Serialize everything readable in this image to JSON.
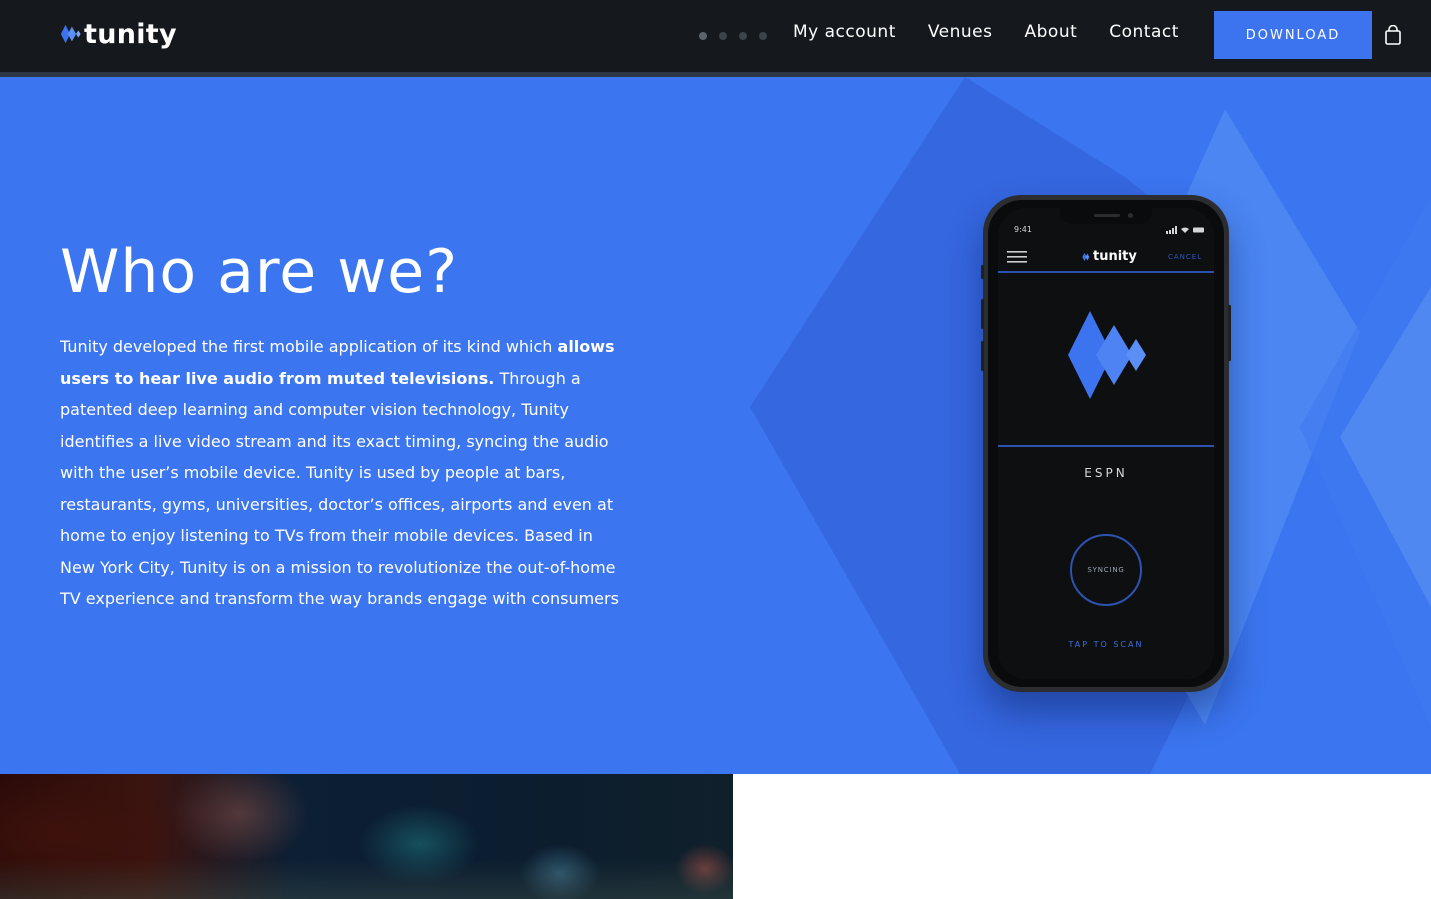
{
  "brand": {
    "logo_text": "tunity",
    "accent": "#3b74ee"
  },
  "nav": {
    "links": [
      "My account",
      "Venues",
      "About",
      "Contact"
    ],
    "download_label": "DOWNLOAD",
    "cart_icon": "shopping-bag-icon",
    "pager_dots": 4
  },
  "hero": {
    "headline": "Who are we?",
    "body_part1": "Tunity developed the first mobile application of its kind which ",
    "body_bold": "allows users to hear live audio from muted televisions.",
    "body_part2": " Through a patented deep learning and computer vision technology, Tunity identifies a live video stream and its exact timing, syncing the audio with the user’s mobile device. Tunity is used by people at bars, restaurants, gyms, universities, doctor’s offices, airports and even at home to enjoy listening to TVs from their mobile devices. Based in New York City, Tunity is on a mission to revolutionize the out-of-home TV experience and transform the way brands engage with consumers",
    "background": "#3b75ef"
  },
  "phone": {
    "time": "9:41",
    "app_logo": "tunity",
    "cancel": "CANCEL",
    "channel": "ESPN",
    "sync_status": "SYNCING",
    "action": "TAP TO SCAN"
  }
}
